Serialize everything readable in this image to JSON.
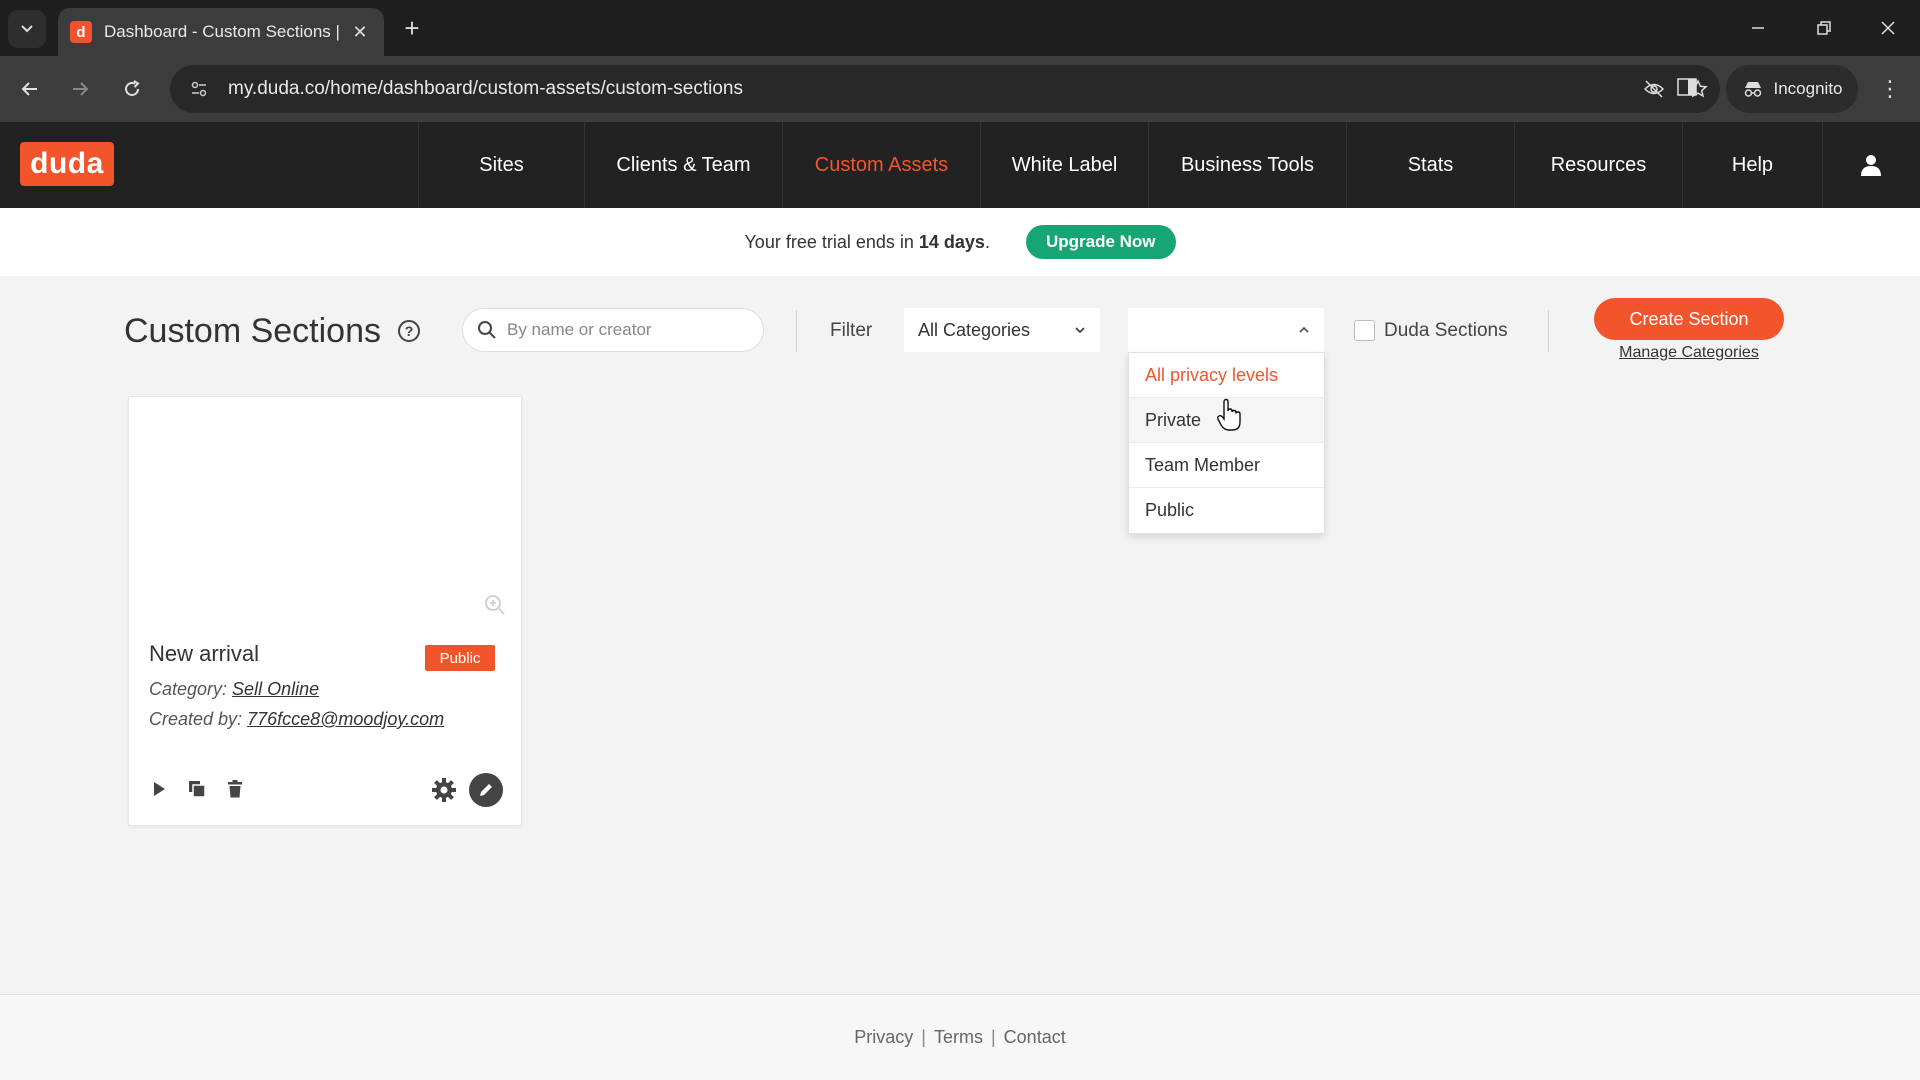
{
  "browser": {
    "tab_title": "Dashboard - Custom Sections |",
    "tab_favicon_letter": "d",
    "url": "my.duda.co/home/dashboard/custom-assets/custom-sections",
    "profile_label": "Incognito"
  },
  "app": {
    "logo_text": "duda",
    "brand_color": "#f2552c",
    "nav": [
      {
        "label": "Sites"
      },
      {
        "label": "Clients & Team"
      },
      {
        "label": "Custom Assets",
        "active": true
      },
      {
        "label": "White Label"
      },
      {
        "label": "Business Tools"
      },
      {
        "label": "Stats"
      },
      {
        "label": "Resources"
      },
      {
        "label": "Help"
      }
    ]
  },
  "trial": {
    "text_before": "Your free trial ends in ",
    "days": "14 days",
    "text_after": ".",
    "upgrade_label": "Upgrade Now",
    "upgrade_color": "#17a673"
  },
  "toolbar": {
    "title": "Custom Sections",
    "search_placeholder": "By name or creator",
    "filter_label": "Filter",
    "category_select": "All Categories",
    "privacy_select": "",
    "privacy_options": [
      "All privacy levels",
      "Private",
      "Team Member",
      "Public"
    ],
    "privacy_selected_index": 0,
    "privacy_hover_index": 1,
    "duda_sections_label": "Duda Sections",
    "create_label": "Create Section",
    "manage_label": "Manage Categories"
  },
  "card": {
    "name": "New arrival",
    "badge": "Public",
    "category_label": "Category: ",
    "category_value": "Sell Online",
    "created_label": "Created by: ",
    "created_value": "776fcce8@moodjoy.com"
  },
  "footer": {
    "links": [
      "Privacy",
      "Terms",
      "Contact"
    ],
    "separator": "|"
  }
}
